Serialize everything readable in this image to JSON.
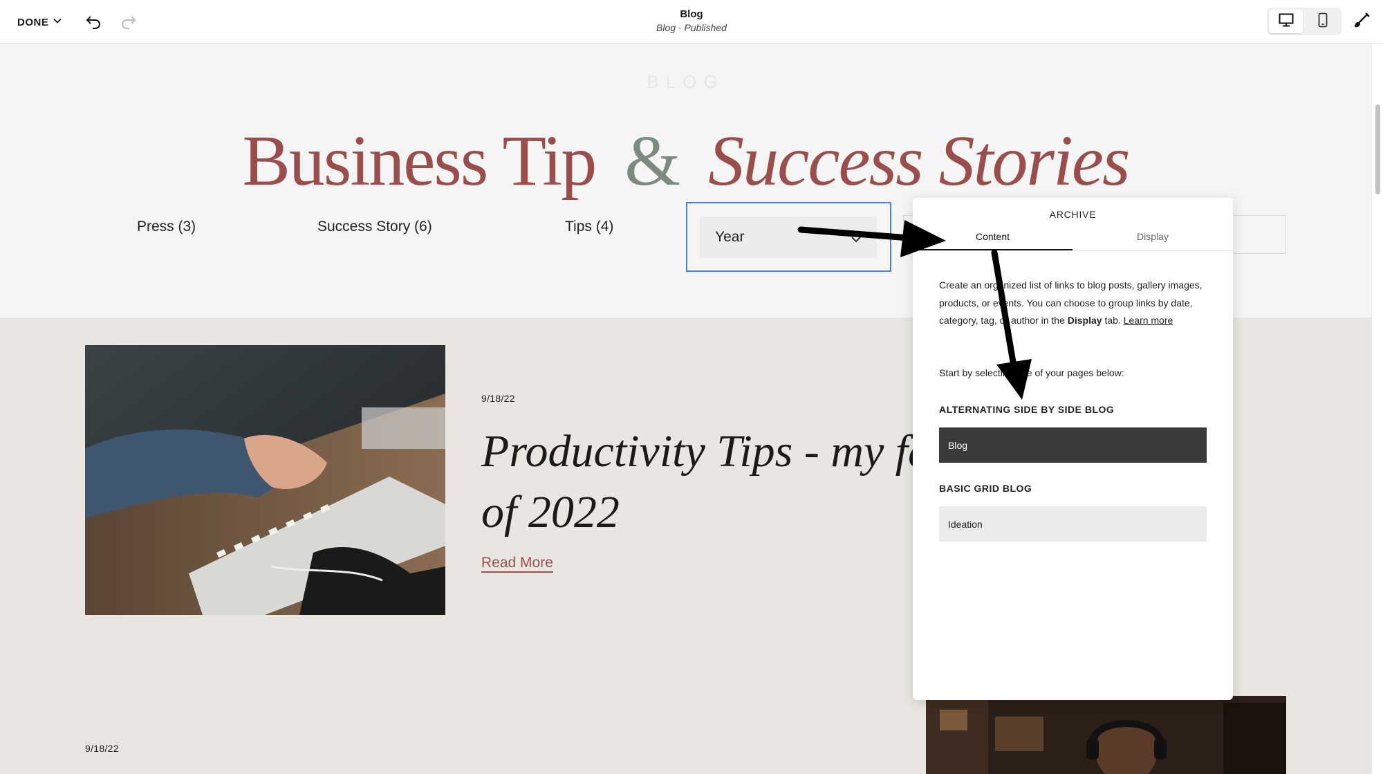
{
  "topbar": {
    "done_label": "DONE",
    "page_title": "Blog",
    "page_subtitle": "Blog · Published"
  },
  "blog": {
    "eyebrow": "BLOG",
    "hero_part1": "Business Tip",
    "hero_amp": "&",
    "hero_part2": "Success Stories",
    "categories": [
      {
        "label": "Press (3)"
      },
      {
        "label": "Success Story (6)"
      },
      {
        "label": "Tips (4)"
      }
    ],
    "archive_select": {
      "value": "Year"
    }
  },
  "posts": [
    {
      "date": "9/18/22",
      "title_line1": "Productivity Tips - my fa",
      "title_line2": "of 2022",
      "read_more": "Read More"
    },
    {
      "date": "9/18/22"
    }
  ],
  "archive_panel": {
    "title": "ARCHIVE",
    "tabs": {
      "content": "Content",
      "display": "Display"
    },
    "desc_part1": "Create an organized list of links to blog posts, gallery images, products, or events. You can choose to group links by date, category, tag, or author in the ",
    "desc_bold": "Display",
    "desc_part2": " tab. ",
    "desc_link": "Learn more",
    "start_text": "Start by selecting one of your pages below:",
    "sections": [
      {
        "label": "ALTERNATING SIDE BY SIDE BLOG",
        "page": "Blog",
        "selected": true
      },
      {
        "label": "BASIC GRID BLOG",
        "page": "Ideation",
        "selected": false
      }
    ]
  },
  "colors": {
    "accent_red": "#9a4e4b",
    "ampersand_green": "#7c8a80",
    "selection_blue": "#4a7fd1",
    "selected_option_bg": "#3a3a3a"
  },
  "icons": [
    "chevron-down-icon",
    "undo-icon",
    "redo-icon",
    "desktop-icon",
    "mobile-icon",
    "brush-icon"
  ]
}
